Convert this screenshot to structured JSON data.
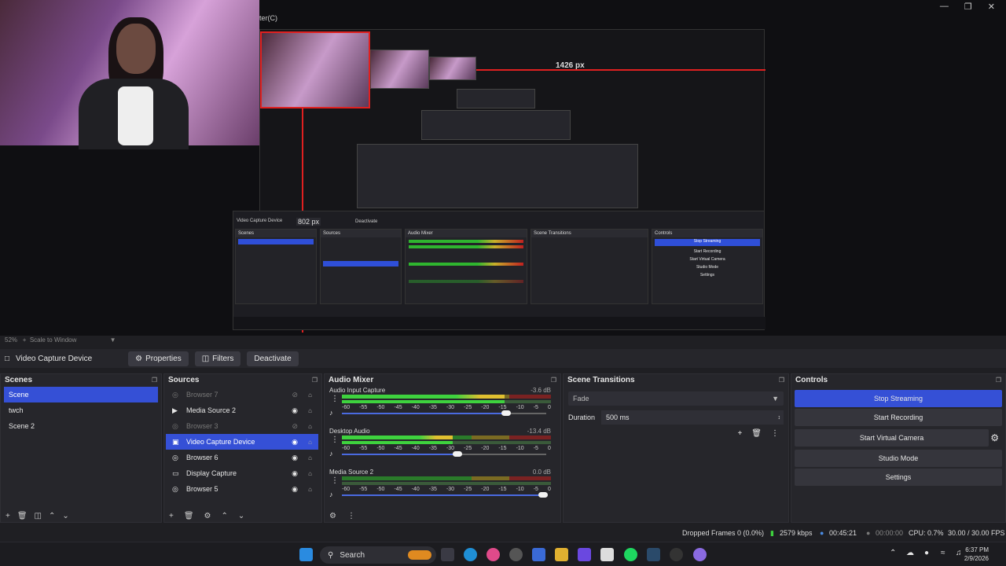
{
  "window": {
    "title_fragment": "ter(C)"
  },
  "preview": {
    "measure_horizontal": "1426 px",
    "measure_vertical": "802 px",
    "scale_text": "52%",
    "scale_mode": "Scale to Window"
  },
  "inner": {
    "source": "Video Capture Device",
    "deactivate": "Deactivate",
    "scenes_h": "Scenes",
    "sources_h": "Sources",
    "mixer_h": "Audio Mixer",
    "trans_h": "Scene Transitions",
    "controls_h": "Controls",
    "stop_streaming": "Stop Streaming",
    "start_recording": "Start Recording",
    "virtual_camera": "Start Virtual Camera",
    "studio_mode": "Studio Mode",
    "settings": "Settings"
  },
  "source_toolbar": {
    "selected_source": "Video Capture Device",
    "properties": "Properties",
    "filters": "Filters",
    "deactivate": "Deactivate"
  },
  "scenes": {
    "title": "Scenes",
    "items": [
      "Scene",
      "twch",
      "Scene 2"
    ],
    "selected": 0
  },
  "sources": {
    "title": "Sources",
    "items": [
      {
        "name": "Browser 7",
        "type": "browser",
        "hidden": true
      },
      {
        "name": "Media Source 2",
        "type": "media",
        "hidden": false
      },
      {
        "name": "Browser 3",
        "type": "browser",
        "hidden": true
      },
      {
        "name": "Video Capture Device",
        "type": "camera",
        "hidden": false,
        "selected": true
      },
      {
        "name": "Browser 6",
        "type": "browser",
        "hidden": false
      },
      {
        "name": "Display Capture",
        "type": "display",
        "hidden": false
      },
      {
        "name": "Browser 5",
        "type": "browser",
        "hidden": false
      }
    ]
  },
  "mixer": {
    "title": "Audio Mixer",
    "scale": [
      "-60",
      "-55",
      "-50",
      "-45",
      "-40",
      "-35",
      "-30",
      "-25",
      "-20",
      "-15",
      "-10",
      "-5",
      "0"
    ],
    "channels": [
      {
        "name": "Audio Input Capture",
        "db": "-3.6 dB",
        "level": 0.78,
        "volume": 0.82
      },
      {
        "name": "Desktop Audio",
        "db": "-13.4 dB",
        "level": 0.53,
        "volume": 0.58
      },
      {
        "name": "Media Source 2",
        "db": "0.0 dB",
        "level": 0.0,
        "volume": 1.0
      }
    ]
  },
  "transitions": {
    "title": "Scene Transitions",
    "type": "Fade",
    "duration_label": "Duration",
    "duration_value": "500 ms"
  },
  "controls": {
    "title": "Controls",
    "stop_streaming": "Stop Streaming",
    "start_recording": "Start Recording",
    "start_virtual_camera": "Start Virtual Camera",
    "studio_mode": "Studio Mode",
    "settings": "Settings"
  },
  "status": {
    "dropped_frames": "Dropped Frames 0 (0.0%)",
    "bitrate": "2579 kbps",
    "stream_time": "00:45:21",
    "rec_time": "00:00:00",
    "cpu": "CPU: 0.7%",
    "fps": "30.00 / 30.00 FPS"
  },
  "taskbar": {
    "search": "Search",
    "time": "6:37 PM",
    "date": "2/9/2026"
  },
  "colors": {
    "accent": "#3550d6",
    "red_guide": "#e02020",
    "meter_green": "#3ed23e"
  }
}
